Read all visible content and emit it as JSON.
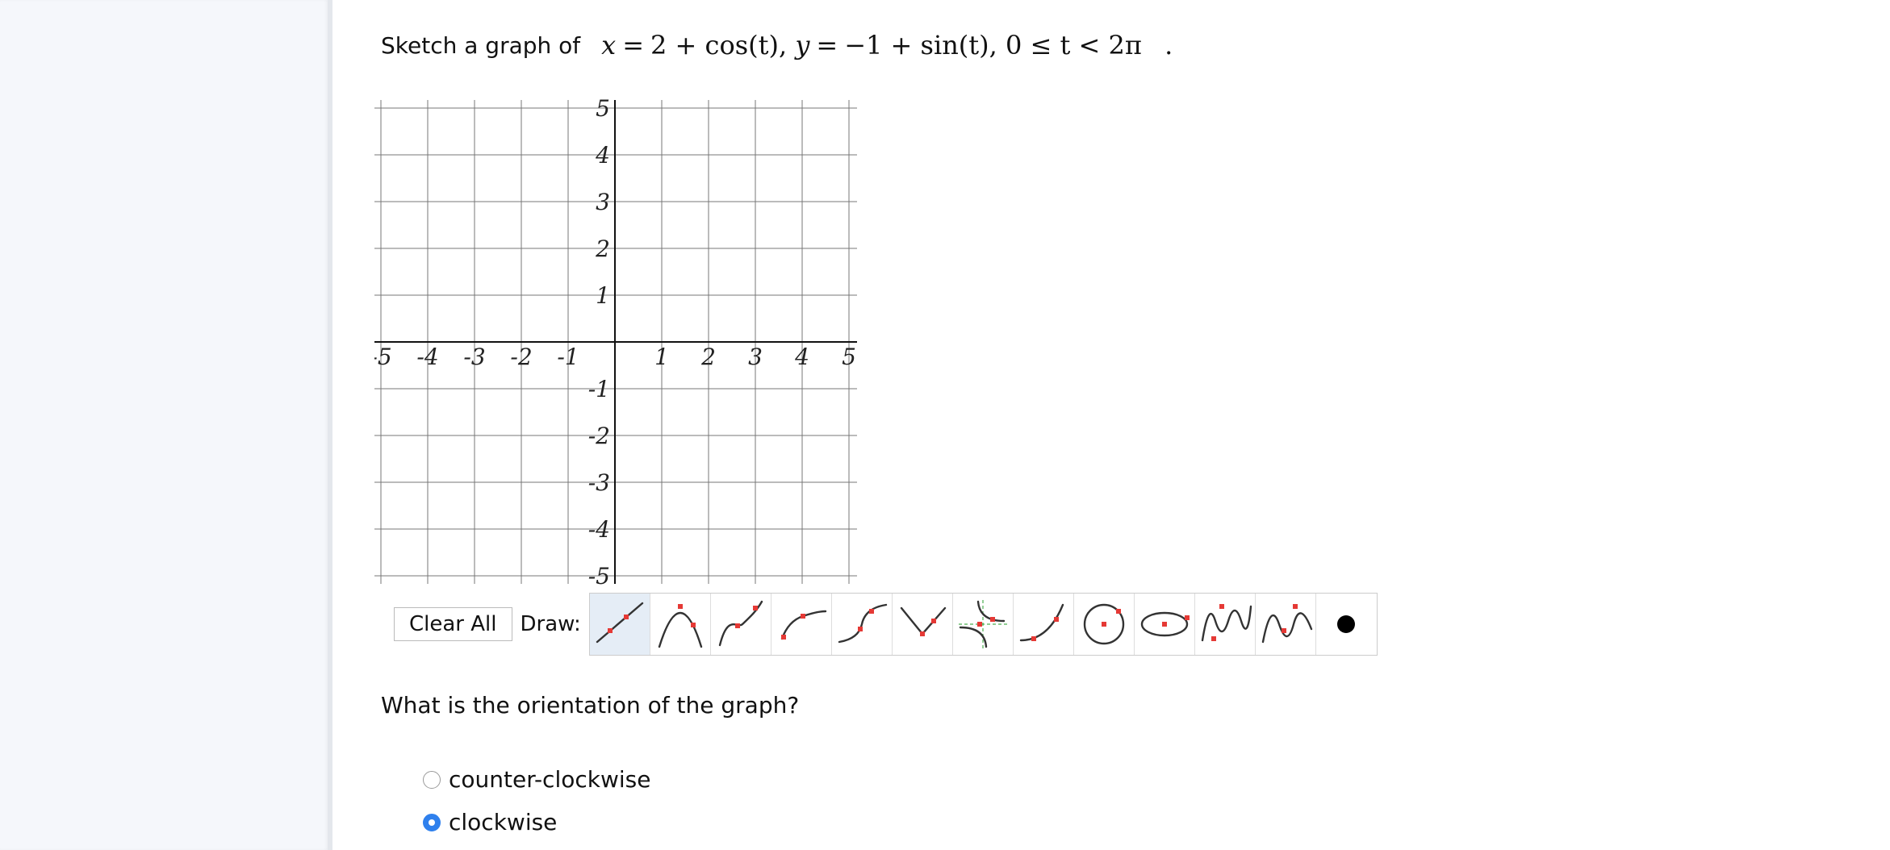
{
  "question": {
    "prompt": "Sketch a graph of",
    "equation_x_var": "x",
    "equation_eq1": "=",
    "equation_x_rhs": "2 + cos(t)",
    "equation_sep": ",",
    "equation_y_var": "y",
    "equation_eq2": "=",
    "equation_y_rhs": "−1 + sin(t), 0 ≤ t < 2π",
    "period": "."
  },
  "graph": {
    "x_range": [
      -5,
      5
    ],
    "y_range": [
      -5,
      5
    ],
    "grid_step": 1,
    "x_tick_labels": [
      "-5",
      "-4",
      "-3",
      "-2",
      "-1",
      "1",
      "2",
      "3",
      "4",
      "5"
    ],
    "y_tick_labels": [
      "5",
      "4",
      "3",
      "2",
      "1",
      "-1",
      "-2",
      "-3",
      "-4",
      "-5"
    ]
  },
  "toolbar": {
    "clear_label": "Clear All",
    "draw_label": "Draw:",
    "tools": [
      {
        "icon": "line-tool-icon",
        "active": true
      },
      {
        "icon": "parabola-tool-icon",
        "active": false
      },
      {
        "icon": "cubic-tool-icon",
        "active": false
      },
      {
        "icon": "sqrt-tool-icon",
        "active": false
      },
      {
        "icon": "cube-root-tool-icon",
        "active": false
      },
      {
        "icon": "absolute-value-tool-icon",
        "active": false
      },
      {
        "icon": "rational-tool-icon",
        "active": false
      },
      {
        "icon": "exponential-tool-icon",
        "active": false
      },
      {
        "icon": "circle-tool-icon",
        "active": false
      },
      {
        "icon": "ellipse-tool-icon",
        "active": false
      },
      {
        "icon": "sine-tool-icon",
        "active": false
      },
      {
        "icon": "cosine-tool-icon",
        "active": false
      },
      {
        "icon": "point-tool-icon",
        "active": false
      }
    ]
  },
  "orientation": {
    "question": "What is the orientation of the graph?",
    "options": [
      {
        "label": "counter-clockwise",
        "checked": false
      },
      {
        "label": "clockwise",
        "checked": true
      }
    ]
  },
  "colors": {
    "accent": "#2f80ed",
    "handle": "#e53935",
    "grid": "#777777"
  }
}
